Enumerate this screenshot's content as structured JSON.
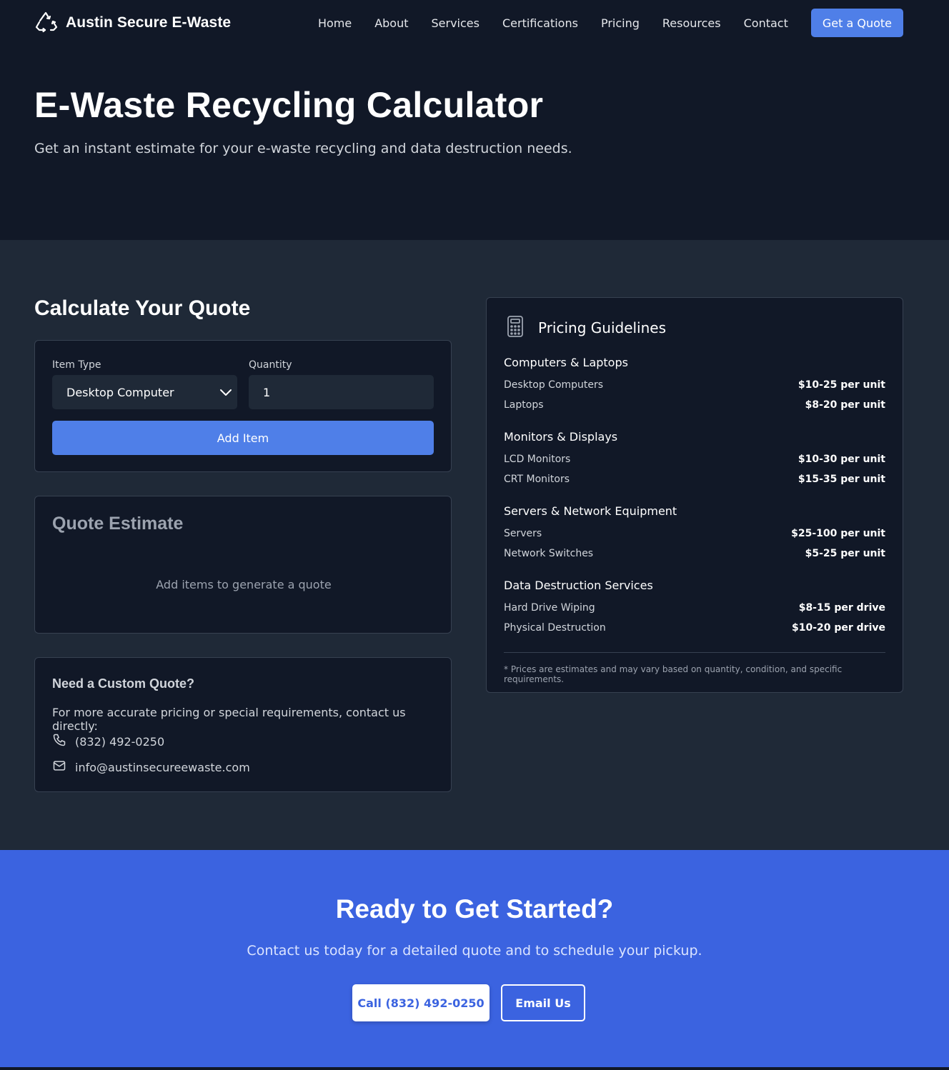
{
  "header": {
    "brand_name": "Austin Secure E-Waste",
    "nav": [
      "Home",
      "About",
      "Services",
      "Certifications",
      "Pricing",
      "Resources",
      "Contact"
    ],
    "cta_label": "Get a Quote",
    "brand_icon": "recycle-icon"
  },
  "hero": {
    "title": "E-Waste Recycling Calculator",
    "subtitle": "Get an instant estimate for your e-waste recycling and data destruction needs."
  },
  "calculator": {
    "title": "Calculate Your Quote",
    "item_type_label": "Item Type",
    "item_type_value": "Desktop Computer",
    "quantity_label": "Quantity",
    "quantity_value": "1",
    "add_button": "Add Item"
  },
  "estimate": {
    "title": "Quote Estimate",
    "empty_text": "Add items to generate a quote"
  },
  "custom_quote": {
    "title": "Need a Custom Quote?",
    "text": "For more accurate pricing or special requirements, contact us directly:",
    "phone": "(832) 492-0250",
    "email": "info@austinsecureewaste.com"
  },
  "pricing": {
    "title": "Pricing Guidelines",
    "icon": "calculator-icon",
    "groups": [
      {
        "title": "Computers & Laptops",
        "items": [
          {
            "name": "Desktop Computers",
            "price": "$10-25 per unit"
          },
          {
            "name": "Laptops",
            "price": "$8-20 per unit"
          }
        ]
      },
      {
        "title": "Monitors & Displays",
        "items": [
          {
            "name": "LCD Monitors",
            "price": "$10-30 per unit"
          },
          {
            "name": "CRT Monitors",
            "price": "$15-35 per unit"
          }
        ]
      },
      {
        "title": "Servers & Network Equipment",
        "items": [
          {
            "name": "Servers",
            "price": "$25-100 per unit"
          },
          {
            "name": "Network Switches",
            "price": "$5-25 per unit"
          }
        ]
      },
      {
        "title": "Data Destruction Services",
        "items": [
          {
            "name": "Hard Drive Wiping",
            "price": "$8-15 per drive"
          },
          {
            "name": "Physical Destruction",
            "price": "$10-20 per drive"
          }
        ]
      }
    ],
    "note": "* Prices are estimates and may vary based on quantity, condition, and specific requirements."
  },
  "cta": {
    "title": "Ready to Get Started?",
    "subtitle": "Contact us today for a detailed quote and to schedule your pickup.",
    "call_button": "Call (832) 492-0250",
    "email_button": "Email Us"
  },
  "colors": {
    "accent": "#4f7fe8",
    "cta_background": "#3b63e0",
    "page_background": "#1f2937",
    "card_background": "#111827"
  }
}
